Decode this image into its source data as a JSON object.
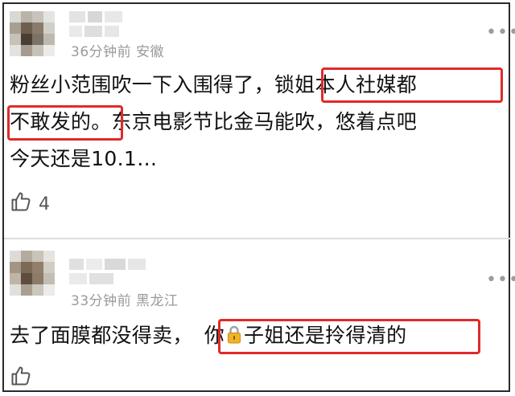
{
  "comments": [
    {
      "meta": "36分钟前 安徽",
      "lines": [
        "粉丝小范围吹一下入围得了，锁姐本人社媒都",
        "不敢发的。东京电影节比金马能吹，悠着点吧",
        "今天还是10.1…"
      ],
      "likes": "4",
      "more_icon": "more-icon",
      "like_icon": "thumbs-up-icon"
    },
    {
      "meta": "33分钟前 黑龙江",
      "text_before": "去了面膜都没得卖，",
      "text_highlight_pre": "你",
      "text_highlight_post": "子姐还是拎得清的",
      "lock_icon": "lock-icon",
      "more_icon": "more-icon",
      "like_icon": "thumbs-up-icon"
    }
  ],
  "colors": {
    "highlight": "#e02a2a",
    "meta": "#9a9a9a",
    "text": "#111111"
  }
}
